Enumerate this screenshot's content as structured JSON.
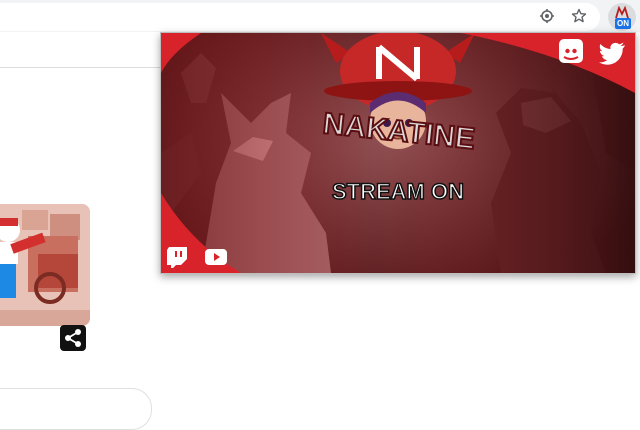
{
  "extension": {
    "badge_text": "ON"
  },
  "banner": {
    "channel_name": "NAKATINE",
    "logo_letter": "N",
    "status_text": "STREAM ON"
  },
  "social_links": [
    "discord",
    "twitter",
    "twitch",
    "youtube"
  ],
  "colors": {
    "accent_red": "#d8232a",
    "badge_blue": "#1a73e8",
    "toolbar_bg": "#f1f3f4"
  },
  "icons": [
    "location-icon",
    "star-icon",
    "share-icon"
  ]
}
